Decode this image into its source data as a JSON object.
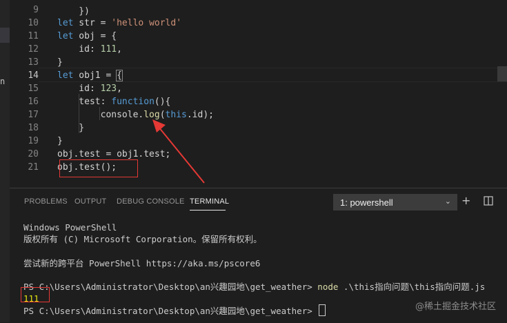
{
  "editor": {
    "top_fragment": "    })",
    "lines": [
      {
        "n": "9",
        "tokens": []
      },
      {
        "n": "10",
        "tokens": [
          {
            "c": "kw",
            "t": "let"
          },
          {
            "c": "plain",
            "t": " str = "
          },
          {
            "c": "str",
            "t": "'hello world'"
          }
        ]
      },
      {
        "n": "11",
        "tokens": [
          {
            "c": "kw",
            "t": "let"
          },
          {
            "c": "plain",
            "t": " obj = {"
          }
        ]
      },
      {
        "n": "12",
        "tokens": [
          {
            "c": "plain",
            "t": "    id: "
          },
          {
            "c": "num-lit",
            "t": "111"
          },
          {
            "c": "plain",
            "t": ","
          }
        ]
      },
      {
        "n": "13",
        "tokens": [
          {
            "c": "plain",
            "t": "}"
          }
        ]
      },
      {
        "n": "14",
        "tokens": [
          {
            "c": "kw",
            "t": "let"
          },
          {
            "c": "plain",
            "t": " obj1 = "
          },
          {
            "c": "brace",
            "t": "{"
          }
        ],
        "active": true
      },
      {
        "n": "15",
        "tokens": [
          {
            "c": "plain",
            "t": "    id: "
          },
          {
            "c": "num-lit",
            "t": "123"
          },
          {
            "c": "plain",
            "t": ","
          }
        ]
      },
      {
        "n": "16",
        "tokens": [
          {
            "c": "plain",
            "t": "    test: "
          },
          {
            "c": "kw",
            "t": "function"
          },
          {
            "c": "plain",
            "t": "(){"
          }
        ]
      },
      {
        "n": "17",
        "tokens": [
          {
            "c": "plain",
            "t": "        console."
          },
          {
            "c": "fn",
            "t": "log"
          },
          {
            "c": "plain",
            "t": "("
          },
          {
            "c": "kw",
            "t": "this"
          },
          {
            "c": "plain",
            "t": ".id);"
          }
        ]
      },
      {
        "n": "18",
        "tokens": [
          {
            "c": "plain",
            "t": "    }"
          }
        ]
      },
      {
        "n": "19",
        "tokens": [
          {
            "c": "plain",
            "t": "}"
          }
        ]
      },
      {
        "n": "20",
        "tokens": [
          {
            "c": "plain",
            "t": "obj.test = obj1.test;"
          }
        ]
      },
      {
        "n": "21",
        "tokens": [
          {
            "c": "plain",
            "t": "obj.test();"
          }
        ]
      }
    ]
  },
  "panel": {
    "tabs": [
      "PROBLEMS",
      "OUTPUT",
      "DEBUG CONSOLE",
      "TERMINAL"
    ],
    "active_tab": "TERMINAL",
    "terminal_select": "1: powershell",
    "icons": [
      "plus-icon",
      "split-icon",
      "chevron-down-icon"
    ]
  },
  "terminal": {
    "lines": [
      {
        "t": "Windows PowerShell"
      },
      {
        "t": "版权所有 (C) Microsoft Corporation。保留所有权利。"
      },
      {
        "t": ""
      },
      {
        "t": "尝试新的跨平台 PowerShell https://aka.ms/pscore6"
      },
      {
        "t": ""
      },
      {
        "prompt": "PS C:\\Users\\Administrator\\Desktop\\an兴趣园地\\get_weather> ",
        "cmd": "node",
        "rest": " .\\this指向问题\\this指向问题.js"
      },
      {
        "out": "111"
      },
      {
        "prompt": "PS C:\\Users\\Administrator\\Desktop\\an兴趣园地\\get_weather> ",
        "cursor": true
      }
    ]
  },
  "activity": {
    "glyph": "n"
  },
  "watermark": "@稀土掘金技术社区",
  "colors": {
    "annotation_red": "#e53935",
    "terminal_output": "#e5e510"
  }
}
